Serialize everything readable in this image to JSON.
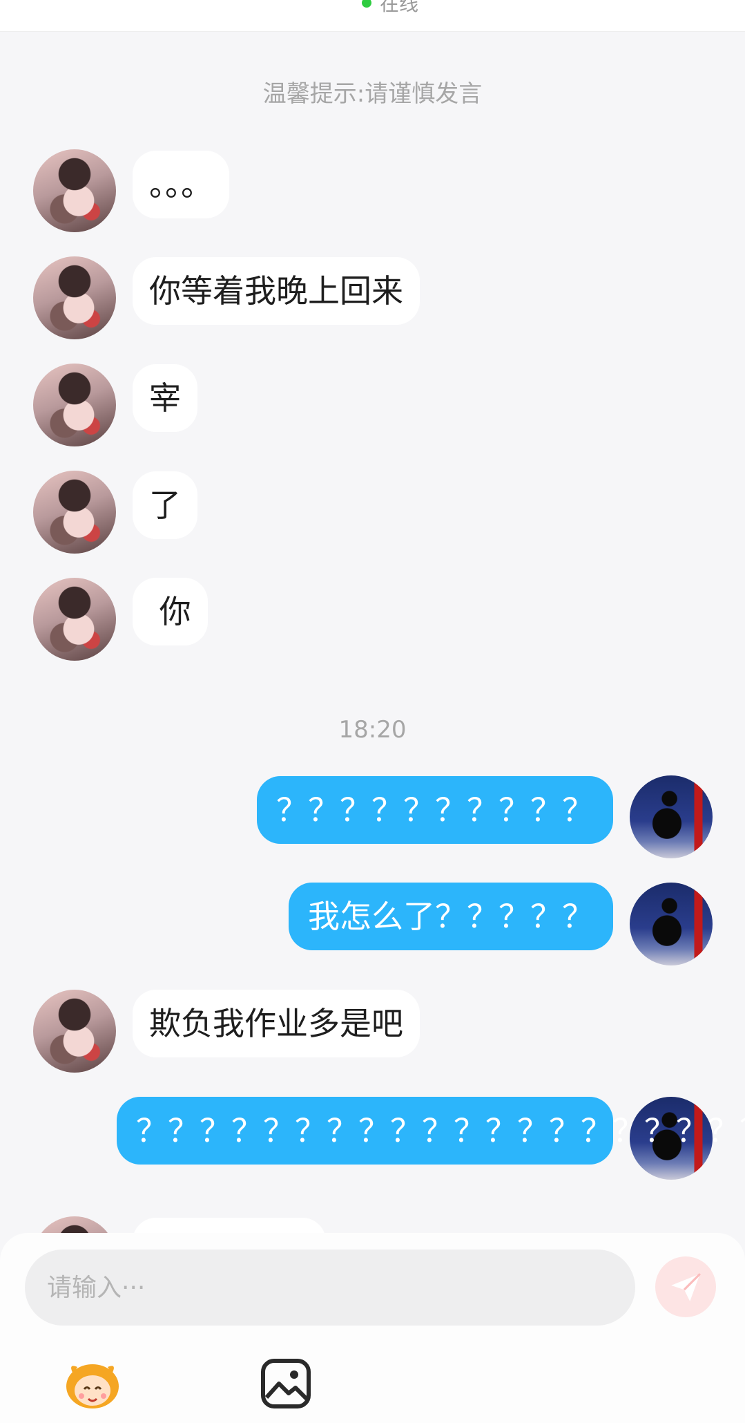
{
  "header": {
    "status_text": "在线"
  },
  "tip": "温馨提示:请谨慎发言",
  "time_divider": "18:20",
  "messages": [
    {
      "from": "other",
      "text": "。。。"
    },
    {
      "from": "other",
      "text": "你等着我晚上回来"
    },
    {
      "from": "other",
      "text": "宰"
    },
    {
      "from": "other",
      "text": "了"
    },
    {
      "from": "other",
      "text": " 你"
    },
    {
      "from": "me",
      "text": "？？？？？？？？？？"
    },
    {
      "from": "me",
      "text": "我怎么了？？？？？"
    },
    {
      "from": "other",
      "text": "欺负我作业多是吧"
    },
    {
      "from": "me",
      "text": "？？？？？？？？？？？？？？？？？？？？？"
    }
  ],
  "composer": {
    "placeholder": "请输入···"
  },
  "colors": {
    "accent": "#2cb5fb",
    "online": "#2ecc40",
    "send": "#fde4e4"
  },
  "icons": {
    "send": "send-icon",
    "emoji": "emoji-icon",
    "image": "image-icon"
  }
}
